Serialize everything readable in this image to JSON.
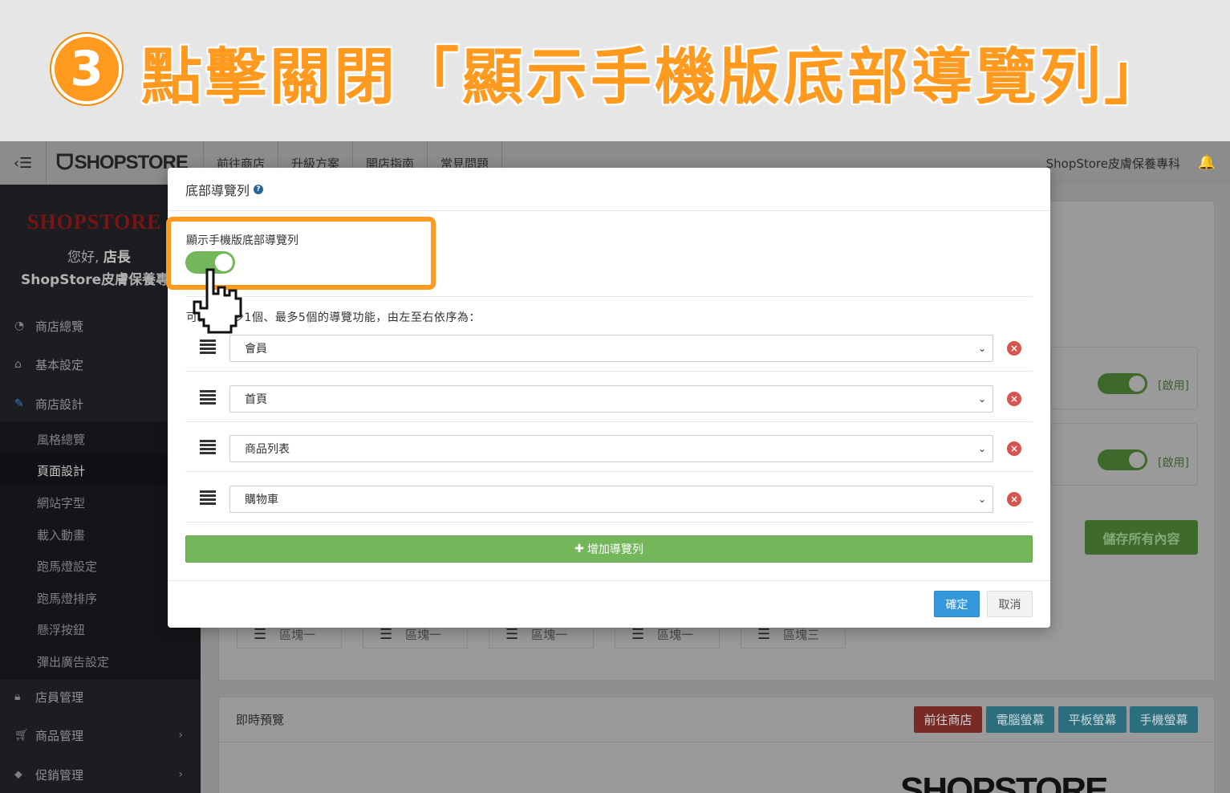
{
  "banner": {
    "step_number": "3",
    "title": "點擊關閉「顯示手機版底部導覽列」"
  },
  "topnav": {
    "toggle_icon": "‹☰",
    "logo": "SHOPSTORE",
    "links": [
      "前往商店",
      "升級方案",
      "開店指南",
      "常見問題"
    ],
    "store_name": "ShopStore皮膚保養專科",
    "bell_icon": "bell-icon"
  },
  "sidebar": {
    "logo": "SHOPSTORE",
    "greeting_prefix": "您好,",
    "greeting_role": "店長",
    "store_name": "ShopStore皮膚保養專科",
    "items": [
      {
        "label": "商店總覽",
        "icon": "dashboard-icon"
      },
      {
        "label": "基本設定",
        "icon": "bank-icon"
      },
      {
        "label": "商店設計",
        "icon": "brush-icon"
      }
    ],
    "sub_items": [
      "風格總覽",
      "頁面設計",
      "網站字型",
      "載入動畫",
      "跑馬燈設定",
      "跑馬燈排序",
      "懸浮按鈕",
      "彈出廣告設定"
    ],
    "active_sub": "頁面設計",
    "more_items": [
      {
        "label": "店員管理",
        "icon": "lock-icon"
      },
      {
        "label": "商品管理",
        "icon": "cart-icon"
      },
      {
        "label": "促銷管理",
        "icon": "tag-icon"
      }
    ]
  },
  "background": {
    "enabled_label": "[啟用]",
    "save_all": "儲存所有內容",
    "blocks": [
      "區塊一",
      "區塊一",
      "區塊一",
      "區塊一",
      "區塊三"
    ],
    "preview_title": "即時預覽",
    "preview_buttons": [
      "前往商店",
      "電腦螢幕",
      "平板螢幕",
      "手機螢幕"
    ],
    "bottom_logo": "SHOPSTORE"
  },
  "modal": {
    "title": "底部導覽列",
    "toggle_label": "顯示手機版底部導覽列",
    "toggle_on": true,
    "description": "可設定至少1個、最多5個的導覽功能，由左至右依序為：",
    "nav_items": [
      "會員",
      "首頁",
      "商品列表",
      "購物車"
    ],
    "add_label": "增加導覽列",
    "ok_label": "確定",
    "cancel_label": "取消"
  },
  "colors": {
    "accent_orange": "#ff9a1f",
    "toggle_green": "#74b65a",
    "primary_blue": "#3498db",
    "danger_red": "#d9534f"
  }
}
